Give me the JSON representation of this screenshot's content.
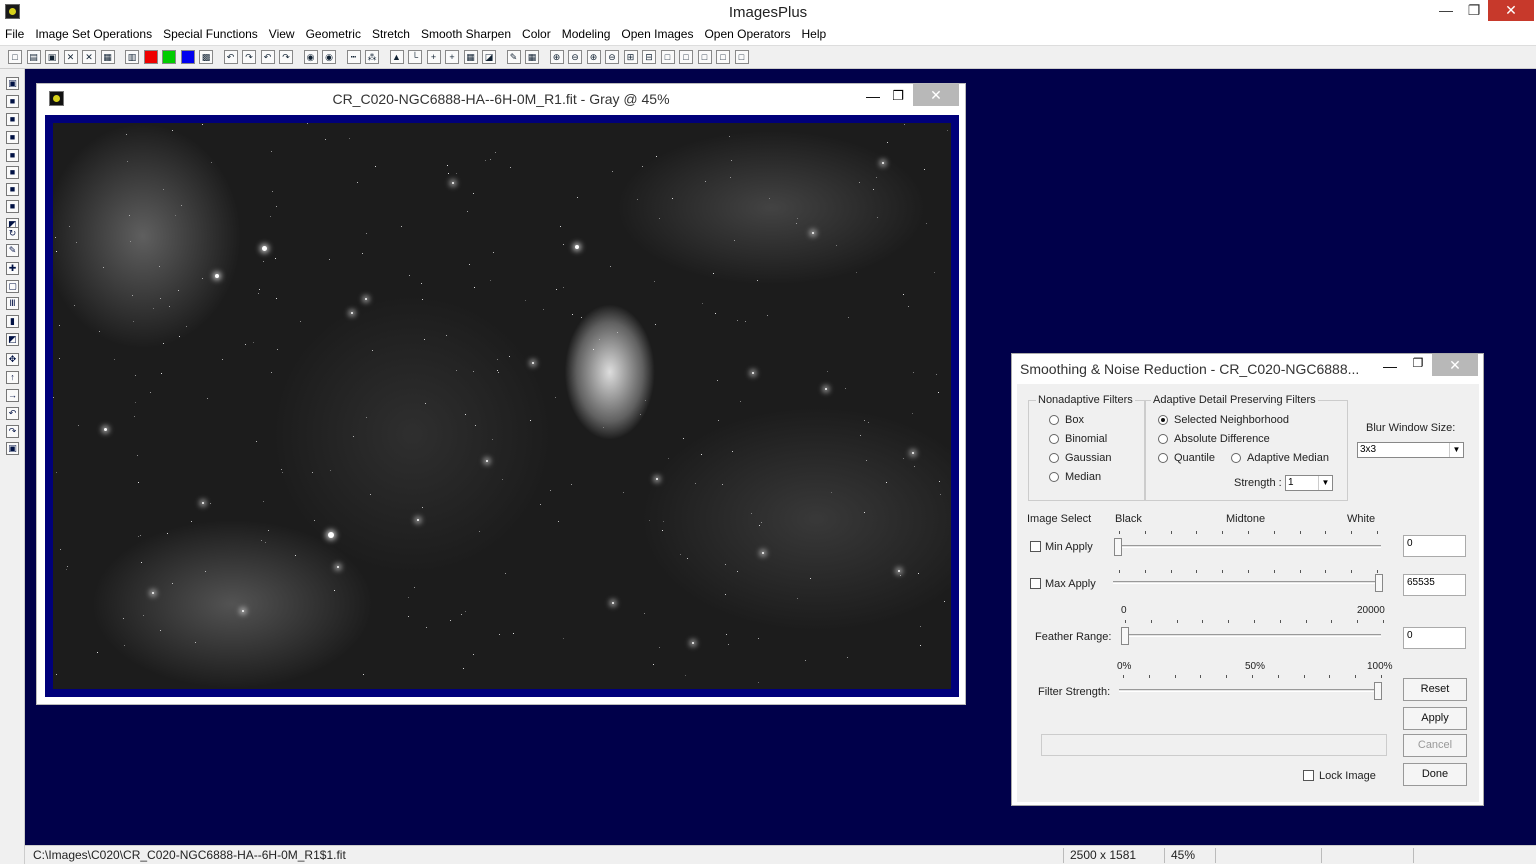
{
  "app": {
    "title": "ImagesPlus"
  },
  "menu": [
    "File",
    "Image Set Operations",
    "Special Functions",
    "View",
    "Geometric",
    "Stretch",
    "Smooth Sharpen",
    "Color",
    "Modeling",
    "Open Images",
    "Open Operators",
    "Help"
  ],
  "toolbar_icons": [
    "new-icon",
    "open-icon",
    "save-icon",
    "close-icon",
    "close-all-icon",
    "print-icon",
    "rgb-icon",
    "red-channel-icon",
    "green-channel-icon",
    "blue-channel-icon",
    "grid-icon",
    "undo-icon",
    "redo-icon",
    "undo-all-icon",
    "redo-all-icon",
    "circle-select-icon",
    "ellipse-select-icon",
    "line-icon",
    "points-icon",
    "mountain-icon",
    "ruler-icon",
    "crosshair-icon",
    "crosshair2-icon",
    "grid2-icon",
    "image-icon",
    "pencil-icon",
    "matrix-icon",
    "zoom-in-icon",
    "zoom-out-icon",
    "zoom-fit-icon",
    "zoom-reset-icon",
    "box-icon",
    "minus-box-icon",
    "frame1-icon",
    "frame2-icon",
    "frame3-icon",
    "frame4-icon",
    "frame5-icon"
  ],
  "image_window": {
    "title": "CR_C020-NGC6888-HA--6H-0M_R1.fit - Gray @ 45%"
  },
  "dialog": {
    "title": "Smoothing & Noise Reduction - CR_C020-NGC6888...",
    "nonadaptive": {
      "label": "Nonadaptive Filters",
      "options": [
        "Box",
        "Binomial",
        "Gaussian",
        "Median"
      ]
    },
    "adaptive": {
      "label": "Adaptive Detail Preserving Filters",
      "selected_neighborhood": "Selected Neighborhood",
      "absolute_difference": "Absolute Difference",
      "quantile": "Quantile",
      "adaptive_median": "Adaptive Median",
      "strength_label": "Strength :",
      "strength_value": "1"
    },
    "blur": {
      "label": "Blur Window Size:",
      "value": "3x3"
    },
    "image_select": "Image Select",
    "black": "Black",
    "midtone": "Midtone",
    "white": "White",
    "min_apply": "Min Apply",
    "min_value": "0",
    "max_apply": "Max Apply",
    "max_value": "65535",
    "feather_min": "0",
    "feather_max": "20000",
    "feather_label": "Feather Range:",
    "feather_value": "0",
    "pct0": "0%",
    "pct50": "50%",
    "pct100": "100%",
    "filter_strength": "Filter Strength:",
    "reset": "Reset",
    "apply": "Apply",
    "cancel": "Cancel",
    "lock_image": "Lock Image",
    "done": "Done"
  },
  "status": {
    "path": "C:\\Images\\C020\\CR_C020-NGC6888-HA--6H-0M_R1$1.fit",
    "dimensions": "2500 x 1581",
    "zoom": "45%"
  }
}
